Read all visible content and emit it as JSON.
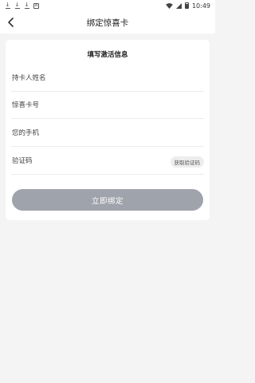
{
  "status_bar": {
    "time": "10:49",
    "notification_icons": [
      "download-icon",
      "download-icon",
      "download-icon",
      "a-icon"
    ],
    "right_icons": [
      "wifi-icon",
      "signal-icon",
      "battery-icon"
    ]
  },
  "header": {
    "title": "绑定惊喜卡",
    "back_icon": "chevron-left-icon"
  },
  "form": {
    "section_title": "填写激活信息",
    "fields": [
      {
        "placeholder": "持卡人姓名",
        "value": ""
      },
      {
        "placeholder": "惊喜卡号",
        "value": ""
      },
      {
        "placeholder": "您的手机",
        "value": ""
      },
      {
        "placeholder": "验证码",
        "value": ""
      }
    ],
    "get_code_label": "获取验证码",
    "submit_label": "立即绑定"
  },
  "colors": {
    "background": "#f4f4f4",
    "card": "#ffffff",
    "submit_button": "#9fa3ab",
    "code_button": "#ededed"
  }
}
